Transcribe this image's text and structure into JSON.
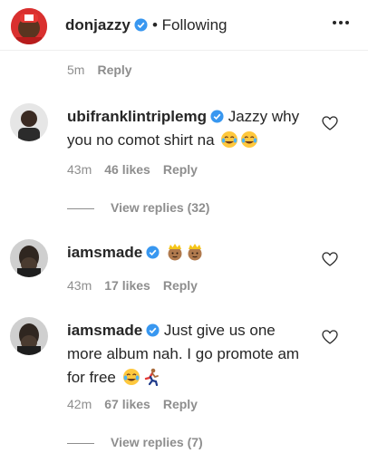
{
  "header": {
    "username": "donjazzy",
    "follow_status": "• Following",
    "more_icon": "more-horizontal-icon"
  },
  "top_meta": {
    "time": "5m",
    "reply": "Reply"
  },
  "comments": [
    {
      "username": "ubifranklintriplemg",
      "text": "Jazzy why you no comot shirt na",
      "time": "43m",
      "likes": "46 likes",
      "reply": "Reply",
      "view_replies": "View replies (32)"
    },
    {
      "username": "iamsmade",
      "text": "",
      "time": "43m",
      "likes": "17 likes",
      "reply": "Reply"
    },
    {
      "username": "iamsmade",
      "text": "Just give us one more album nah. I go promote am for free",
      "time": "42m",
      "likes": "67 likes",
      "reply": "Reply",
      "view_replies": "View replies (7)"
    }
  ],
  "colors": {
    "verified": "#3897f0",
    "meta": "#8e8e8e",
    "text": "#262626"
  }
}
